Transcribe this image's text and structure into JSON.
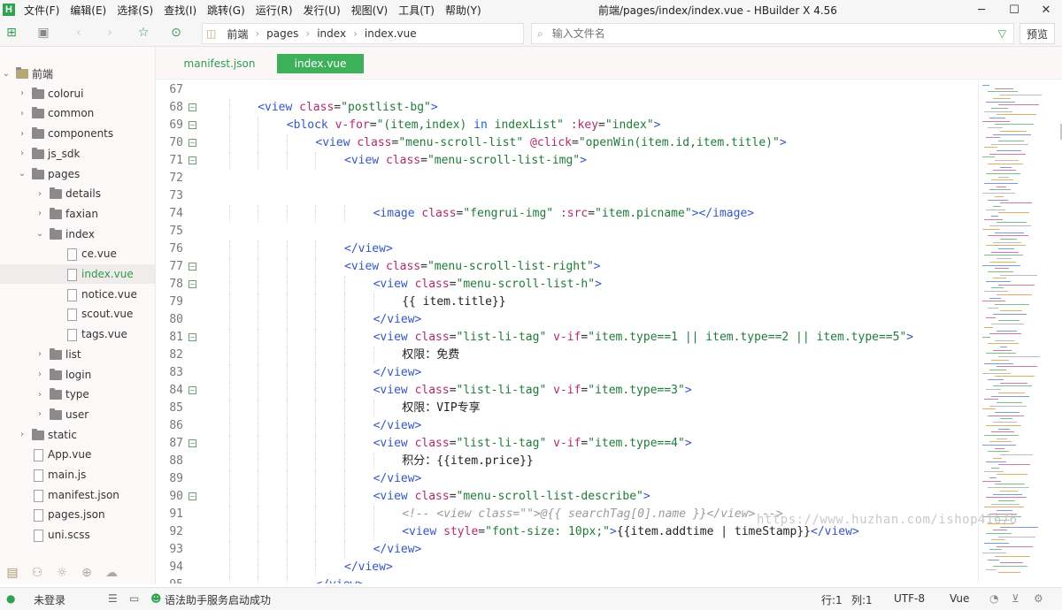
{
  "app": {
    "logo_letter": "H",
    "window_title": "前端/pages/index/index.vue - HBuilder X 4.56"
  },
  "menu": [
    "文件(F)",
    "编辑(E)",
    "选择(S)",
    "查找(I)",
    "跳转(G)",
    "运行(R)",
    "发行(U)",
    "视图(V)",
    "工具(T)",
    "帮助(Y)"
  ],
  "breadcrumb": [
    "前端",
    "pages",
    "index",
    "index.vue"
  ],
  "file_search": {
    "placeholder": "输入文件名"
  },
  "preview_label": "预览",
  "tree": [
    {
      "label": "前端",
      "kind": "project",
      "depth": 0,
      "expanded": true
    },
    {
      "label": "colorui",
      "kind": "folder",
      "depth": 1,
      "expanded": false
    },
    {
      "label": "common",
      "kind": "folder",
      "depth": 1,
      "expanded": false
    },
    {
      "label": "components",
      "kind": "folder",
      "depth": 1,
      "expanded": false
    },
    {
      "label": "js_sdk",
      "kind": "folder",
      "depth": 1,
      "expanded": false
    },
    {
      "label": "pages",
      "kind": "folder",
      "depth": 1,
      "expanded": true
    },
    {
      "label": "details",
      "kind": "folder",
      "depth": 2,
      "expanded": false
    },
    {
      "label": "faxian",
      "kind": "folder",
      "depth": 2,
      "expanded": false
    },
    {
      "label": "index",
      "kind": "folder",
      "depth": 2,
      "expanded": true
    },
    {
      "label": "ce.vue",
      "kind": "file",
      "depth": 3
    },
    {
      "label": "index.vue",
      "kind": "file",
      "depth": 3,
      "selected": true
    },
    {
      "label": "notice.vue",
      "kind": "file",
      "depth": 3
    },
    {
      "label": "scout.vue",
      "kind": "file",
      "depth": 3
    },
    {
      "label": "tags.vue",
      "kind": "file",
      "depth": 3
    },
    {
      "label": "list",
      "kind": "folder",
      "depth": 2,
      "expanded": false
    },
    {
      "label": "login",
      "kind": "folder",
      "depth": 2,
      "expanded": false
    },
    {
      "label": "type",
      "kind": "folder",
      "depth": 2,
      "expanded": false
    },
    {
      "label": "user",
      "kind": "folder",
      "depth": 2,
      "expanded": false
    },
    {
      "label": "static",
      "kind": "folder",
      "depth": 1,
      "expanded": false
    },
    {
      "label": "App.vue",
      "kind": "file",
      "depth": 1
    },
    {
      "label": "main.js",
      "kind": "file",
      "depth": 1
    },
    {
      "label": "manifest.json",
      "kind": "file",
      "depth": 1
    },
    {
      "label": "pages.json",
      "kind": "file",
      "depth": 1
    },
    {
      "label": "uni.scss",
      "kind": "file",
      "depth": 1
    }
  ],
  "tabs": [
    {
      "label": "manifest.json",
      "active": false
    },
    {
      "label": "index.vue",
      "active": true
    }
  ],
  "code_lines": [
    {
      "n": "67",
      "indent": 0,
      "fold": false,
      "segs": []
    },
    {
      "n": "68",
      "indent": 2,
      "fold": true,
      "segs": [
        [
          "t",
          "<view "
        ],
        [
          "a",
          "class"
        ],
        [
          "p",
          "="
        ],
        [
          "s",
          "\"postlist-bg\""
        ],
        [
          "t",
          ">"
        ]
      ]
    },
    {
      "n": "69",
      "indent": 3,
      "fold": true,
      "segs": [
        [
          "t",
          "<block "
        ],
        [
          "a",
          "v-for"
        ],
        [
          "p",
          "="
        ],
        [
          "s",
          "\"(item,index) "
        ],
        [
          "k",
          "in"
        ],
        [
          "s",
          " indexList\" "
        ],
        [
          "a",
          ":key"
        ],
        [
          "p",
          "="
        ],
        [
          "s",
          "\"index\""
        ],
        [
          "t",
          ">"
        ]
      ]
    },
    {
      "n": "70",
      "indent": 4,
      "fold": true,
      "segs": [
        [
          "t",
          "<view "
        ],
        [
          "a",
          "class"
        ],
        [
          "p",
          "="
        ],
        [
          "s",
          "\"menu-scroll-list\" "
        ],
        [
          "a",
          "@click"
        ],
        [
          "p",
          "="
        ],
        [
          "s",
          "\"openWin(item.id,item.title)\""
        ],
        [
          "t",
          ">"
        ]
      ]
    },
    {
      "n": "71",
      "indent": 5,
      "fold": true,
      "segs": [
        [
          "t",
          "<view "
        ],
        [
          "a",
          "class"
        ],
        [
          "p",
          "="
        ],
        [
          "s",
          "\"menu-scroll-list-img\""
        ],
        [
          "t",
          ">"
        ]
      ]
    },
    {
      "n": "72",
      "indent": 0,
      "fold": false,
      "segs": []
    },
    {
      "n": "73",
      "indent": 0,
      "fold": false,
      "segs": []
    },
    {
      "n": "74",
      "indent": 6,
      "fold": false,
      "segs": [
        [
          "t",
          "<image "
        ],
        [
          "a",
          "class"
        ],
        [
          "p",
          "="
        ],
        [
          "s",
          "\"fengrui-img\" "
        ],
        [
          "a",
          ":src"
        ],
        [
          "p",
          "="
        ],
        [
          "s",
          "\"item.picname\""
        ],
        [
          "t",
          "></image>"
        ]
      ]
    },
    {
      "n": "75",
      "indent": 0,
      "fold": false,
      "segs": []
    },
    {
      "n": "76",
      "indent": 5,
      "fold": false,
      "segs": [
        [
          "t",
          "</view>"
        ]
      ]
    },
    {
      "n": "77",
      "indent": 5,
      "fold": true,
      "segs": [
        [
          "t",
          "<view "
        ],
        [
          "a",
          "class"
        ],
        [
          "p",
          "="
        ],
        [
          "s",
          "\"menu-scroll-list-right\""
        ],
        [
          "t",
          ">"
        ]
      ]
    },
    {
      "n": "78",
      "indent": 6,
      "fold": true,
      "segs": [
        [
          "t",
          "<view "
        ],
        [
          "a",
          "class"
        ],
        [
          "p",
          "="
        ],
        [
          "s",
          "\"menu-scroll-list-h\""
        ],
        [
          "t",
          ">"
        ]
      ]
    },
    {
      "n": "79",
      "indent": 7,
      "fold": false,
      "segs": [
        [
          "txt",
          "{{ item.title}}"
        ]
      ]
    },
    {
      "n": "80",
      "indent": 6,
      "fold": false,
      "segs": [
        [
          "t",
          "</view>"
        ]
      ]
    },
    {
      "n": "81",
      "indent": 6,
      "fold": true,
      "segs": [
        [
          "t",
          "<view "
        ],
        [
          "a",
          "class"
        ],
        [
          "p",
          "="
        ],
        [
          "s",
          "\"list-li-tag\" "
        ],
        [
          "a",
          "v-if"
        ],
        [
          "p",
          "="
        ],
        [
          "s",
          "\"item.type==1 || item.type==2 || item.type==5\""
        ],
        [
          "t",
          ">"
        ]
      ]
    },
    {
      "n": "82",
      "indent": 7,
      "fold": false,
      "segs": [
        [
          "txt",
          "权限：免费"
        ]
      ]
    },
    {
      "n": "83",
      "indent": 6,
      "fold": false,
      "segs": [
        [
          "t",
          "</view>"
        ]
      ]
    },
    {
      "n": "84",
      "indent": 6,
      "fold": true,
      "segs": [
        [
          "t",
          "<view "
        ],
        [
          "a",
          "class"
        ],
        [
          "p",
          "="
        ],
        [
          "s",
          "\"list-li-tag\" "
        ],
        [
          "a",
          "v-if"
        ],
        [
          "p",
          "="
        ],
        [
          "s",
          "\"item.type==3\""
        ],
        [
          "t",
          ">"
        ]
      ]
    },
    {
      "n": "85",
      "indent": 7,
      "fold": false,
      "segs": [
        [
          "txt",
          "权限：VIP专享"
        ]
      ]
    },
    {
      "n": "86",
      "indent": 6,
      "fold": false,
      "segs": [
        [
          "t",
          "</view>"
        ]
      ]
    },
    {
      "n": "87",
      "indent": 6,
      "fold": true,
      "segs": [
        [
          "t",
          "<view "
        ],
        [
          "a",
          "class"
        ],
        [
          "p",
          "="
        ],
        [
          "s",
          "\"list-li-tag\" "
        ],
        [
          "a",
          "v-if"
        ],
        [
          "p",
          "="
        ],
        [
          "s",
          "\"item.type==4\""
        ],
        [
          "t",
          ">"
        ]
      ]
    },
    {
      "n": "88",
      "indent": 7,
      "fold": false,
      "segs": [
        [
          "txt",
          "积分：{{item.price}}"
        ]
      ]
    },
    {
      "n": "89",
      "indent": 6,
      "fold": false,
      "segs": [
        [
          "t",
          "</view>"
        ]
      ]
    },
    {
      "n": "90",
      "indent": 6,
      "fold": true,
      "segs": [
        [
          "t",
          "<view "
        ],
        [
          "a",
          "class"
        ],
        [
          "p",
          "="
        ],
        [
          "s",
          "\"menu-scroll-list-describe\""
        ],
        [
          "t",
          ">"
        ]
      ]
    },
    {
      "n": "91",
      "indent": 7,
      "fold": false,
      "segs": [
        [
          "c",
          "<!-- <view class=\"\">@{{ searchTag[0].name }}</view> -->"
        ]
      ]
    },
    {
      "n": "92",
      "indent": 7,
      "fold": false,
      "segs": [
        [
          "t",
          "<view "
        ],
        [
          "a",
          "style"
        ],
        [
          "p",
          "="
        ],
        [
          "s",
          "\"font-size: 10px;\""
        ],
        [
          "t",
          ">"
        ],
        [
          "txt",
          "{{item.addtime | timeStamp}}"
        ],
        [
          "t",
          "</view>"
        ]
      ]
    },
    {
      "n": "93",
      "indent": 6,
      "fold": false,
      "segs": [
        [
          "t",
          "</view>"
        ]
      ]
    },
    {
      "n": "94",
      "indent": 5,
      "fold": false,
      "segs": [
        [
          "t",
          "</view>"
        ]
      ]
    },
    {
      "n": "95",
      "indent": 4,
      "fold": false,
      "segs": [
        [
          "t",
          "</view>"
        ]
      ]
    }
  ],
  "watermark": "https://www.huzhan.com/ishop41676",
  "status": {
    "login": "未登录",
    "syntax_msg": "语法助手服务启动成功",
    "position": "行:1",
    "column": "列:1",
    "encoding": "UTF-8",
    "language": "Vue"
  },
  "colors": {
    "accent": "#3db05a",
    "tag": "#3557c2",
    "attr": "#b02b6d",
    "string": "#1f7a3a"
  }
}
